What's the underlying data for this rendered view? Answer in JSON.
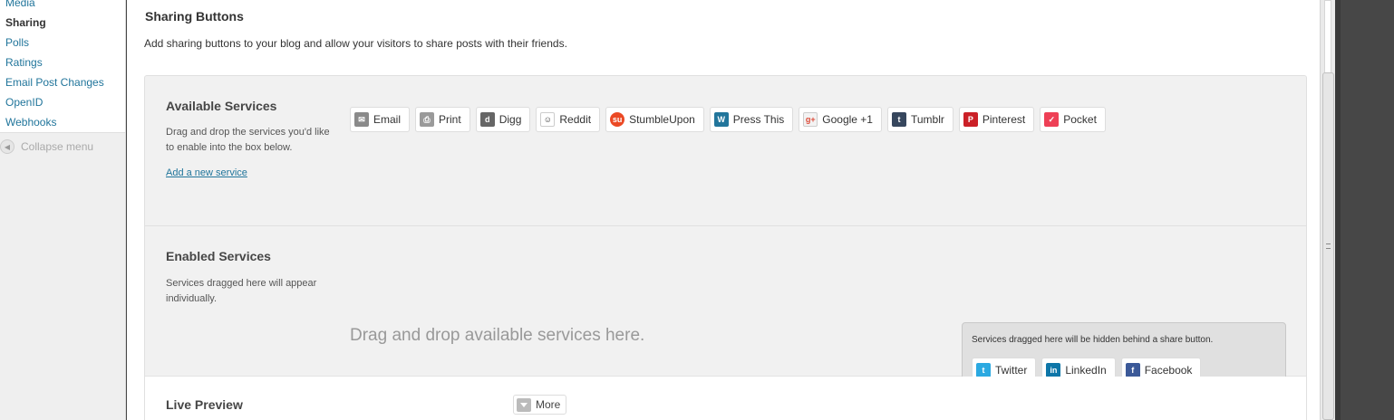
{
  "sidebar": {
    "items": [
      {
        "label": "Media",
        "current": false
      },
      {
        "label": "Sharing",
        "current": true
      },
      {
        "label": "Polls",
        "current": false
      },
      {
        "label": "Ratings",
        "current": false
      },
      {
        "label": "Email Post Changes",
        "current": false
      },
      {
        "label": "OpenID",
        "current": false
      },
      {
        "label": "Webhooks",
        "current": false
      }
    ],
    "collapse_label": "Collapse menu"
  },
  "page": {
    "title": "Sharing Buttons",
    "description": "Add sharing buttons to your blog and allow your visitors to share posts with their friends."
  },
  "available": {
    "title": "Available Services",
    "description": "Drag and drop the services you'd like to enable into the box below.",
    "add_link": "Add a new service",
    "services": [
      {
        "label": "Email",
        "icon": "email-icon",
        "color": "#8a8a8a"
      },
      {
        "label": "Print",
        "icon": "print-icon",
        "color": "#9a9a9a"
      },
      {
        "label": "Digg",
        "icon": "digg-icon",
        "color": "#666666"
      },
      {
        "label": "Reddit",
        "icon": "reddit-icon",
        "color": "#ff4500"
      },
      {
        "label": "StumbleUpon",
        "icon": "stumbleupon-icon",
        "color": "#eb4924"
      },
      {
        "label": "Press This",
        "icon": "wordpress-icon",
        "color": "#21759b"
      },
      {
        "label": "Google +1",
        "icon": "google-plus-icon",
        "color": "#dd4b39"
      },
      {
        "label": "Tumblr",
        "icon": "tumblr-icon",
        "color": "#36465d"
      },
      {
        "label": "Pinterest",
        "icon": "pinterest-icon",
        "color": "#cb2027"
      },
      {
        "label": "Pocket",
        "icon": "pocket-icon",
        "color": "#ee4056"
      }
    ]
  },
  "enabled": {
    "title": "Enabled Services",
    "description": "Services dragged here will appear individually.",
    "drop_placeholder": "Drag and drop available services here.",
    "hidden_note": "Services dragged here will be hidden behind a share button.",
    "hidden_services": [
      {
        "label": "Twitter",
        "icon": "twitter-icon",
        "color": "#2ba9e1"
      },
      {
        "label": "LinkedIn",
        "icon": "linkedin-icon",
        "color": "#0e76a8"
      },
      {
        "label": "Facebook",
        "icon": "facebook-icon",
        "color": "#3b5998"
      }
    ]
  },
  "preview": {
    "title": "Live Preview",
    "more_label": "More"
  }
}
